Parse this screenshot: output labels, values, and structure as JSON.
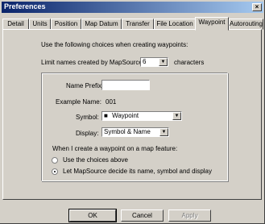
{
  "window": {
    "title": "Preferences",
    "close_label": "×"
  },
  "tabs": [
    "Detail",
    "Units",
    "Position",
    "Map Datum",
    "Transfer",
    "File Location",
    "Waypoint",
    "Autorouting"
  ],
  "intro": "Use the following choices when creating waypoints:",
  "limit": {
    "prefix": "Limit names created by MapSource to",
    "value": "6",
    "suffix": "characters"
  },
  "fields": {
    "name_prefix_label": "Name Prefix:",
    "name_prefix_value": "",
    "example_name_label": "Example Name:",
    "example_name_value": "001",
    "symbol_label": "Symbol:",
    "symbol_value": "Waypoint",
    "display_label": "Display:",
    "display_value": "Symbol & Name"
  },
  "map_feature": {
    "heading": "When I create a waypoint on a map feature:",
    "option1": "Use the choices above",
    "option2": "Let MapSource decide its name, symbol and display",
    "selected": 2
  },
  "buttons": {
    "ok": "OK",
    "cancel": "Cancel",
    "apply": "Apply"
  },
  "icons": {
    "dropdown": "▼",
    "symbol": "■"
  }
}
